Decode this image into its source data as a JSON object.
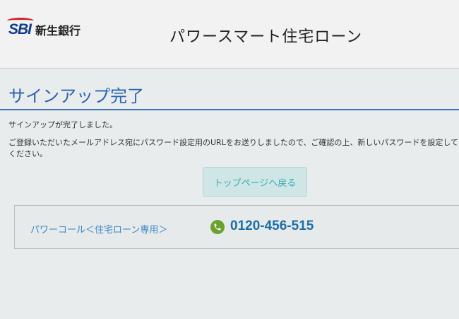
{
  "header": {
    "logo_mark": "SBI",
    "logo_text": "新生銀行",
    "app_title": "パワースマート住宅ローン"
  },
  "page": {
    "heading": "サインアップ完了",
    "message_1": "サインアップが完了しました。",
    "message_2": "ご登録いただいたメールアドレス宛にパスワード設定用のURLをお送りしましたので、ご確認の上、新しいパスワードを設定してください。",
    "back_button": "トップページへ戻る"
  },
  "contact": {
    "label": "パワーコール＜住宅ローン専用＞",
    "phone_icon": "phone-icon",
    "phone_number": "0120-456-515"
  },
  "colors": {
    "brand_blue": "#2a63b3",
    "button_bg": "#cfe6e6",
    "phone_green": "#6aa12f"
  }
}
